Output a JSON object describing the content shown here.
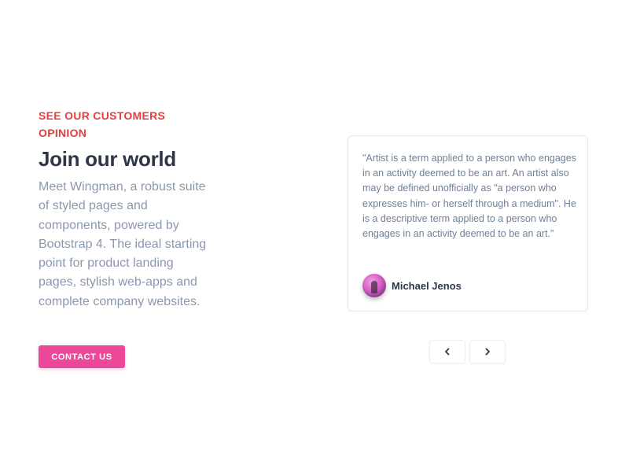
{
  "hero": {
    "eyebrow": "SEE OUR CUSTOMERS OPINION",
    "title": "Join our world",
    "description": "Meet Wingman, a robust suite of styled pages and components, powered by Bootstrap 4. The ideal starting point for product landing pages, stylish web-apps and complete company websites.",
    "cta_label": "CONTACT US"
  },
  "testimonial": {
    "quote": "\"Artist is a term applied to a person who engages in an activity deemed to be an art. An artist also may be defined unofficially as \"a person who expresses him- or herself through a medium\". He is a descriptive term applied to a person who engages in an activity deemed to be an art.\"",
    "author_name": "Michael Jenos"
  },
  "carousel": {
    "prev_icon": "chevron-left-icon",
    "next_icon": "chevron-right-icon"
  },
  "colors": {
    "eyebrow": "#e53e3e",
    "title": "#2d3748",
    "body_text": "#8a98ae",
    "cta_background": "#ec4899",
    "card_border": "#e2e8f0"
  }
}
